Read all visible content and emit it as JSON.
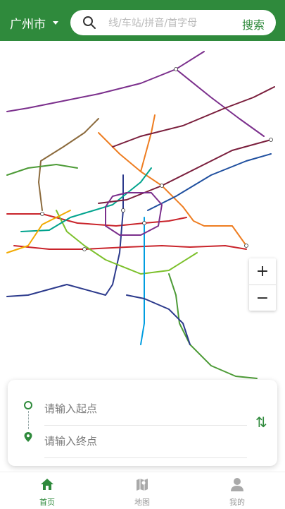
{
  "header": {
    "city": "广州市",
    "search_placeholder": "线/车站/拼音/首字母",
    "search_button": "搜索"
  },
  "map": {
    "zoom_in": "+",
    "zoom_out": "−",
    "line_colors": [
      "#c9242b",
      "#f2a900",
      "#ee7d21",
      "#009de0",
      "#7cc02b",
      "#7b2f8c",
      "#00a38d",
      "#7a1e3c",
      "#2c3a8c",
      "#4d9b37",
      "#1f4f9f",
      "#8b6a3c"
    ]
  },
  "route": {
    "start_placeholder": "请输入起点",
    "end_placeholder": "请输入终点",
    "swap_symbol": "⇅"
  },
  "tabs": [
    {
      "label": "首页",
      "active": true
    },
    {
      "label": "地图",
      "active": false
    },
    {
      "label": "我的",
      "active": false
    }
  ],
  "colors": {
    "accent": "#2f8a3c",
    "inactive": "#9a9a9a"
  }
}
